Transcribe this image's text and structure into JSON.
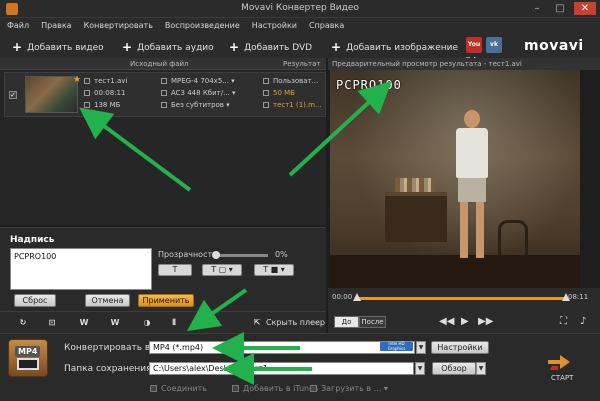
{
  "window": {
    "title": "Movavi Конвертер Видео"
  },
  "menu": [
    "Файл",
    "Правка",
    "Конвертировать",
    "Воспроизведение",
    "Настройки",
    "Справка"
  ],
  "toolbar": {
    "add_video": "Добавить видео",
    "add_audio": "Добавить аудио",
    "add_dvd": "Добавить DVD",
    "add_image": "Добавить изображение",
    "social": [
      "You Tube",
      "vk"
    ],
    "logo": "movavi"
  },
  "file_table": {
    "col_source": "Исходный файл",
    "col_result": "Результат",
    "row": {
      "name": "тест1.avi",
      "duration": "00:08:11",
      "size": "138 МБ",
      "video": "MPEG-4 704x5...",
      "audio": "AC3 448 Кбит/...",
      "subtitles": "Без субтитров",
      "result_profile": "Пользоват...",
      "result_size": "50 МБ",
      "result_name": "тест1 (1).m..."
    }
  },
  "caption": {
    "title": "Надпись",
    "text": "PCPRO100",
    "transparency_label": "Прозрачность",
    "transparency_value": "0%",
    "reset": "Сброс",
    "cancel": "Отмена",
    "apply": "Применить"
  },
  "tools": {
    "hide_player": "Скрыть плеер"
  },
  "preview": {
    "title": "Предварительный просмотр результата - тест1.avi",
    "watermark": "PCPRO100",
    "time_start": "00:00",
    "time_end": "08:11",
    "before": "До",
    "after": "После",
    "trim_fraction_start": 0.0,
    "trim_fraction_end": 1.0
  },
  "output": {
    "convert_label": "Конвертировать в:",
    "convert_value": "MP4 (*.mp4)",
    "intel_badge": "Intel HD Graphics",
    "settings": "Настройки",
    "folder_label": "Папка сохранения:",
    "folder_value": "C:\\Users\\alex\\Desktop\\тест1",
    "browse": "Обзор",
    "join": "Соединить",
    "add_itunes": "Добавить в iTunes",
    "upload": "Загрузить в ...",
    "start": "СТАРТ",
    "format_icon": "MP4"
  },
  "colors": {
    "accent": "#e59a25",
    "arrows": "#22b14c"
  }
}
